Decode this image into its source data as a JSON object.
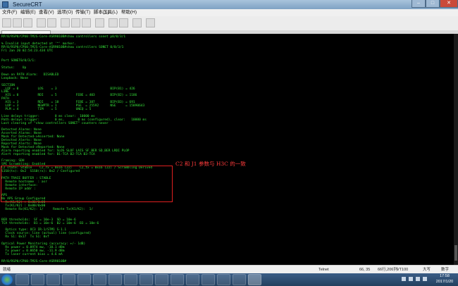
{
  "window": {
    "title": "SecureCRT"
  },
  "menu": [
    "文件(F)",
    "编辑(E)",
    "查看(V)",
    "选项(O)",
    "传输(T)",
    "脚本(S)",
    "工具(L)",
    "帮助(H)"
  ],
  "terminal": {
    "lines": [
      "RP/0/RSP0/CPU0:TMJS-Core-ASR9010B#show controllers sonet p0/0/3/1",
      "",
      "% Invalid input detected at '^' marker.",
      "RP/0/RSP0/CPU0:TMJS-Core-ASR9010B#show controllers SONET 0/0/3/1",
      "Fri Jan 20 02:54:23.434 UTC",
      "",
      "",
      "Port SONET0/0/3/1:",
      "",
      "Status:    Up",
      "",
      "Down on PATH Alarm:   DISABLED",
      "Loopback: None",
      "",
      "SECTION",
      "  LOF = 0          LOS    = 3                            BIP(B1) = 426",
      "LINE",
      "  AIS = 0          RDI    = 5          FEBE = 403        BIP(B2) = 1186",
      "PATH",
      "  AIS = 3          RDI    = 18         FEBE = 387        BIP(B3) = 691",
      "  LOP = 3          NEWPTR = 1          PSE  = 25592      NSE     = 15890643",
      "  PLM = 4          TIM    = 5          UNEQ = 5",
      "",
      "Line delays trigger:        0 ms clear:  10000 ms",
      "Path delays trigger:        0 ms,       0 ms (configured), clear:   10000 ms",
      "Last clearing of \"show controllers SONET\" counters never",
      "",
      "Detected Alarms: None",
      "Asserted Alarms: None",
      "Mask for Detected->Asserted: None",
      "Detected Alerts: None",
      "Reported Alerts: None",
      "Mask for Detected->Reported: None",
      "Alarm reporting enabled for: SLOS SLOF LAIS SF_BER SD_BER LRDI PLOP",
      "Alert reporting enabled for: B1-TCA B2-TCA B3-TCA",
      "",
      "Framing: SDH",
      "SPE Scrambling: Enabled",
      "C2 state: Stable    C2_rx = 0x16 (22)    C2_tx = 0x16 (22) / Scrambling Derived",
      "S1S0(tx): 0x2  S1S0(rx): 0x2 / Configured",
      "",
      "PATH TRACE BUFFER : STABLE",
      "  Remote hostname  : asr",
      "  Remote interface:",
      "  Remote IP addr :",
      "",
      "APS",
      "No APS Group Configured",
      "  Rx(K1/K2) : 0x00/0x00",
      "  Tx(K1/K2) : 0x00/0x00",
      "  Remote Rx(K1/K2): 1/     Remote Tx(K1/K2):  1/",
      "",
      "",
      "BER thresholds:  SF = 10e-3  SD = 10e-6",
      "TCA thresholds:  B1 = 10e-6  B2 = 10e-6  B3 = 10e-6",
      "",
      "  Optics type: OC3 IR-1/STM1 S-1.1",
      "  Clock source: line (actual) line (configured)",
      "  Rx S1: 0x17  Tx S1: 0xf",
      "",
      "Optical Power Monitoring (accuracy: +/- 1dB)",
      "  Rx power = 0.0974 mw, -10.1 dBm",
      "  Tx power = 0.0650 mw, -11.9 dBm",
      "  Tx laser current bias = 4.6 mA",
      "",
      "RP/0/RSP0/CPU0:TMJS-Core-ASR9010B#"
    ],
    "annotation": "C2 和 J1 参数与 H3C 的一致"
  },
  "status": {
    "ready": "就绪",
    "protocol": "Telnet",
    "cursor": "66, 35",
    "size": "66行,206列",
    "terminal": "VT100",
    "caps": "大写",
    "num": "数字"
  },
  "clock": {
    "time": "17:58",
    "date": "2017/1/20"
  },
  "accent": "#36e23a",
  "highlight": "#e02020"
}
